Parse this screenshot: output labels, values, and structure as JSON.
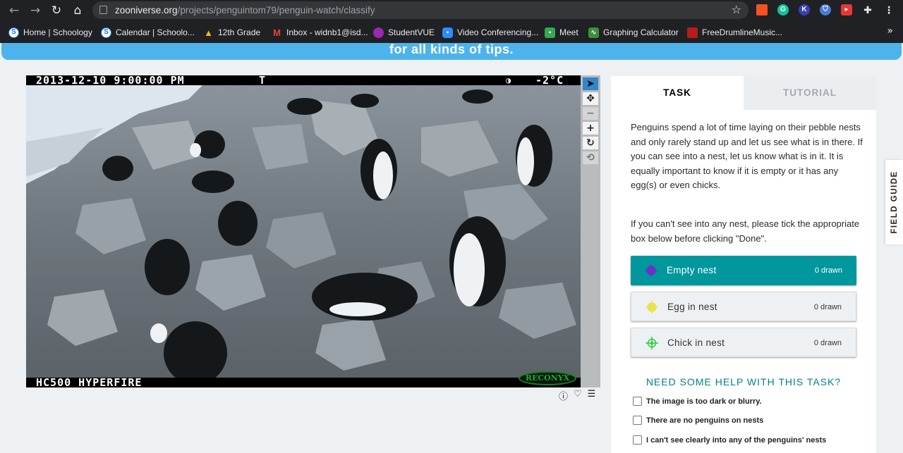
{
  "browser": {
    "url_host": "zooniverse.org",
    "url_path": "/projects/penguintom79/penguin-watch/classify"
  },
  "bookmarks": [
    {
      "label": "Home | Schoology",
      "color": "#ffffff",
      "glyph": "S"
    },
    {
      "label": "Calendar | Schoolo...",
      "color": "#ffffff",
      "glyph": "S"
    },
    {
      "label": "12th Grade",
      "color": "#fbbc04",
      "glyph": "▲"
    },
    {
      "label": "Inbox - widnb1@isd...",
      "color": "#ea4335",
      "glyph": "M"
    },
    {
      "label": "StudentVUE",
      "color": "#9c27b0",
      "glyph": "●"
    },
    {
      "label": "Video Conferencing...",
      "color": "#2d8cff",
      "glyph": "■"
    },
    {
      "label": "Meet",
      "color": "#34a853",
      "glyph": "■"
    },
    {
      "label": "Graphing Calculator",
      "color": "#3c8f3c",
      "glyph": "∿"
    },
    {
      "label": "FreeDrumlineMusic...",
      "color": "#b71c1c",
      "glyph": "■"
    }
  ],
  "banner": {
    "text": "for all kinds of tips."
  },
  "camera": {
    "timestamp": "2013-12-10  9:00:00 PM",
    "t_flag": "T",
    "moon_icon": "moon-phase-icon",
    "temperature": "-2°C",
    "model": "HC500 HYPERFIRE",
    "brand": "RECONYX"
  },
  "tools": [
    "pointer-icon",
    "move-icon",
    "zoom-out-icon",
    "zoom-in-icon",
    "rotate-icon",
    "reset-icon"
  ],
  "tabs": {
    "task": "TASK",
    "tutorial": "TUTORIAL"
  },
  "instructions": {
    "p1": "Penguins spend a lot of time laying on their pebble nests and only rarely stand up and let us see what is in there. If you can see into a nest, let us know what is in it. It is equally important to know if it is empty or it has any egg(s) or even chicks.",
    "p2": "If you can't see into any nest, please tick the appropriate box below before clicking \"Done\"."
  },
  "drawing_tools": [
    {
      "label": "Empty nest",
      "count": "0 drawn",
      "marker_color": "#6a33c7",
      "active": true
    },
    {
      "label": "Egg in nest",
      "count": "0 drawn",
      "marker_color": "#e8e34a",
      "active": false
    },
    {
      "label": "Chick in nest",
      "count": "0 drawn",
      "marker_color": "#2ecc40",
      "active": false
    }
  ],
  "help_link": "NEED SOME HELP WITH THIS TASK?",
  "checkboxes": [
    "The image is too dark or blurry.",
    "There are no penguins on nests",
    "I can't see clearly into any of the penguins' nests"
  ],
  "field_guide": "FIELD GUIDE"
}
